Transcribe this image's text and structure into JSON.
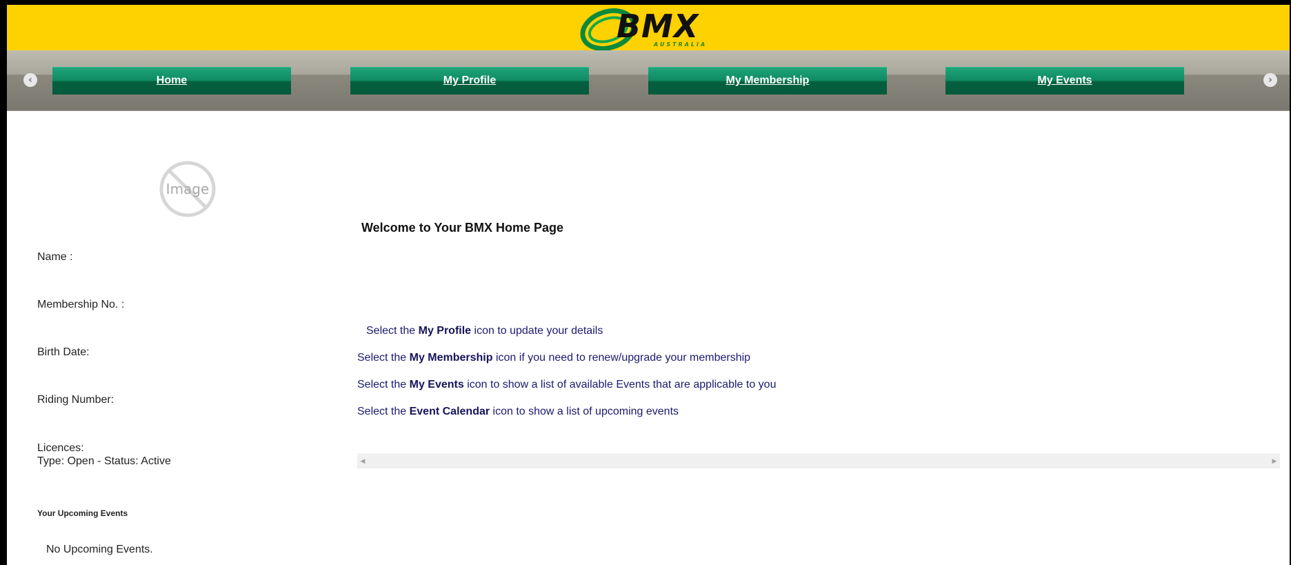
{
  "header": {
    "logo_text": "BMX",
    "logo_subtext": "AUSTRALIA",
    "brand_yellow": "#fed100",
    "brand_green": "#0a7a52"
  },
  "nav": {
    "prev_icon": "chevron-left-circle-icon",
    "next_icon": "chevron-right-circle-icon",
    "items": [
      {
        "label": "Home"
      },
      {
        "label": "My Profile"
      },
      {
        "label": "My Membership"
      },
      {
        "label": "My Events"
      }
    ]
  },
  "sidebar": {
    "image_placeholder": "Image",
    "name_label": "Name :",
    "membership_label": "Membership No. :",
    "birth_date_label": "Birth Date:",
    "riding_number_label": "Riding Number:",
    "licences_label": "Licences:",
    "licence_detail": "Type: Open - Status: Active",
    "upcoming_heading": "Your Upcoming Events",
    "upcoming_empty": "No Upcoming Events."
  },
  "main": {
    "welcome": "Welcome to Your BMX Home Page",
    "instructions": [
      {
        "pre": "Select the ",
        "bold": "My Profile",
        "post": " icon to update your details"
      },
      {
        "pre": "Select the ",
        "bold": "My Membership",
        "post": " icon if you need to renew/upgrade your membership"
      },
      {
        "pre": "Select the ",
        "bold": "My Events",
        "post": " icon to show a list of available Events that are applicable to you"
      },
      {
        "pre": "Select the ",
        "bold": "Event Calendar",
        "post": " icon to show a list of upcoming events"
      }
    ]
  }
}
